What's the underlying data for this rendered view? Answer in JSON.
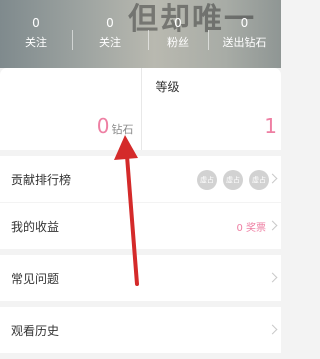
{
  "header": {
    "background_text": "但却唯一",
    "stats": [
      {
        "value": "0",
        "label": "关注"
      },
      {
        "value": "0",
        "label": "关注"
      },
      {
        "value": "0",
        "label": "粉丝"
      },
      {
        "value": "0",
        "label": "送出钻石"
      }
    ]
  },
  "summary": {
    "diamonds": {
      "value": "0",
      "unit": "钻石"
    },
    "level": {
      "label": "等级",
      "value": "1"
    }
  },
  "menu": {
    "contribution": {
      "label": "贡献排行榜",
      "empty_seat_labels": [
        "虚占",
        "虚占",
        "虚占"
      ]
    },
    "earnings": {
      "label": "我的收益",
      "value": "0 奖票"
    },
    "faq": {
      "label": "常见问题"
    },
    "history": {
      "label": "观看历史"
    }
  },
  "colors": {
    "accent": "#ee7fa3",
    "annotation_arrow": "#d42a2a"
  }
}
